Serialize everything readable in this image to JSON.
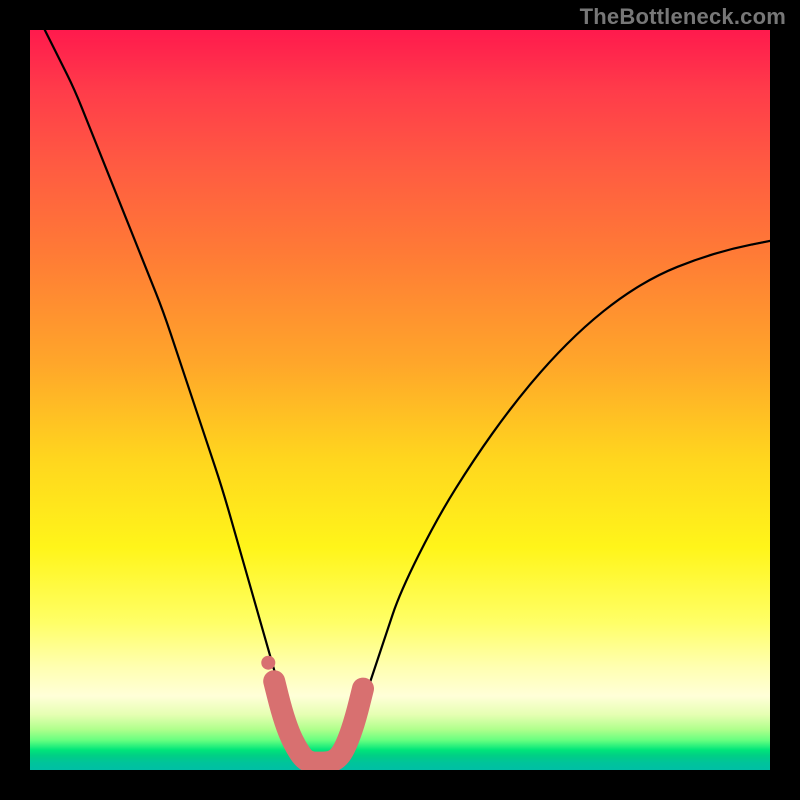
{
  "attribution": "TheBottleneck.com",
  "chart_data": {
    "type": "line",
    "title": "",
    "xlabel": "",
    "ylabel": "",
    "xlim": [
      0,
      100
    ],
    "ylim": [
      0,
      100
    ],
    "grid": false,
    "series": [
      {
        "name": "bottleneck-curve",
        "color": "#000000",
        "x": [
          2,
          4,
          6,
          8,
          10,
          12,
          14,
          16,
          18,
          20,
          22,
          24,
          26,
          28,
          30,
          32,
          34,
          36,
          38,
          40,
          42,
          44,
          46,
          48,
          50,
          55,
          60,
          65,
          70,
          75,
          80,
          85,
          90,
          95,
          100
        ],
        "y": [
          100,
          96,
          92,
          87,
          82,
          77,
          72,
          67,
          62,
          56,
          50,
          44,
          38,
          31,
          24,
          17,
          10,
          5,
          2,
          0.5,
          2,
          6,
          12,
          18,
          24,
          34,
          42,
          49,
          55,
          60,
          64,
          67,
          69,
          70.5,
          71.5
        ]
      },
      {
        "name": "highlight-region",
        "color": "#d87070",
        "x": [
          33,
          34,
          35,
          36,
          37,
          38,
          39,
          40,
          41,
          42,
          43,
          44,
          45
        ],
        "y": [
          12,
          8,
          5,
          3,
          1.5,
          1,
          1,
          1,
          1.2,
          2,
          4,
          7,
          11
        ]
      }
    ],
    "background_gradient_stops": [
      {
        "pos": 0.0,
        "color": "#ff1a4d"
      },
      {
        "pos": 0.3,
        "color": "#ff7a36"
      },
      {
        "pos": 0.6,
        "color": "#ffe61e"
      },
      {
        "pos": 0.8,
        "color": "#ffff66"
      },
      {
        "pos": 0.9,
        "color": "#ffffd8"
      },
      {
        "pos": 0.95,
        "color": "#b0ff8c"
      },
      {
        "pos": 1.0,
        "color": "#00c49a"
      }
    ]
  }
}
